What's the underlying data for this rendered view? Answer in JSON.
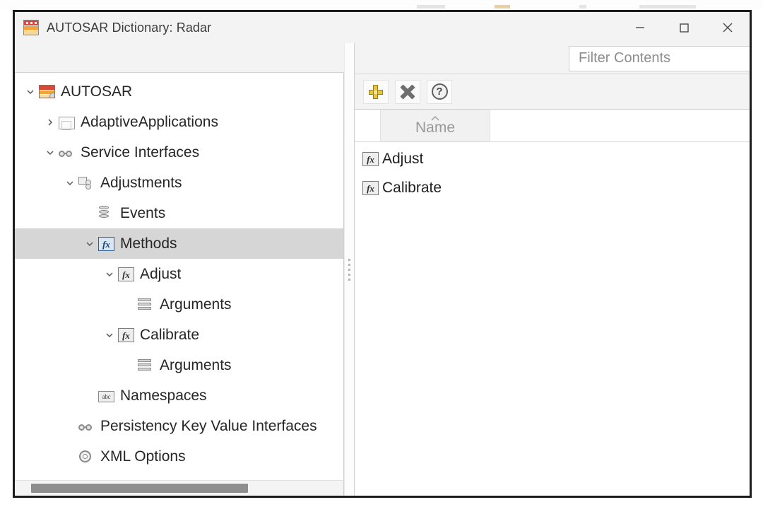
{
  "window": {
    "title": "AUTOSAR Dictionary: Radar",
    "icon": "autosar-app-icon",
    "controls": {
      "minimize": "minimize-icon",
      "maximize": "maximize-icon",
      "close": "close-icon"
    }
  },
  "tree": {
    "nodes": [
      {
        "label": "AUTOSAR",
        "level": 0,
        "icon": "autosar-icon",
        "twisty": "expanded",
        "selected": false
      },
      {
        "label": "AdaptiveApplications",
        "level": 1,
        "icon": "package-square-icon",
        "twisty": "collapsed",
        "selected": false
      },
      {
        "label": "Service Interfaces",
        "level": 1,
        "icon": "service-interface-icon",
        "twisty": "expanded",
        "selected": false
      },
      {
        "label": "Adjustments",
        "level": 2,
        "icon": "adjustments-icon",
        "twisty": "expanded",
        "selected": false
      },
      {
        "label": "Events",
        "level": 3,
        "icon": "events-database-icon",
        "twisty": "none",
        "selected": false
      },
      {
        "label": "Methods",
        "level": 3,
        "icon": "fx-icon-selected",
        "twisty": "expanded",
        "selected": true
      },
      {
        "label": "Adjust",
        "level": 4,
        "icon": "fx-icon",
        "twisty": "expanded",
        "selected": false
      },
      {
        "label": "Arguments",
        "level": 5,
        "icon": "arguments-rows-icon",
        "twisty": "none",
        "selected": false
      },
      {
        "label": "Calibrate",
        "level": 4,
        "icon": "fx-icon",
        "twisty": "expanded",
        "selected": false
      },
      {
        "label": "Arguments",
        "level": 5,
        "icon": "arguments-rows-icon",
        "twisty": "none",
        "selected": false
      },
      {
        "label": "Namespaces",
        "level": 3,
        "icon": "abc-icon",
        "twisty": "none",
        "selected": false
      },
      {
        "label": "Persistency Key Value Interfaces",
        "level": 2,
        "icon": "service-interface-icon",
        "twisty": "none",
        "selected": false
      },
      {
        "label": "XML Options",
        "level": 2,
        "icon": "gear-icon",
        "twisty": "none",
        "selected": false
      }
    ],
    "abc_glyph": "abc"
  },
  "filter": {
    "placeholder": "Filter Contents",
    "value": ""
  },
  "toolbar": {
    "add_label": "add-icon",
    "delete_label": "delete-icon",
    "help_label": "?"
  },
  "list": {
    "column_header": "Name",
    "sort_direction": "ascending",
    "rows": [
      {
        "name": "Adjust",
        "icon": "fx-icon"
      },
      {
        "name": "Calibrate",
        "icon": "fx-icon"
      }
    ]
  },
  "colors": {
    "selection": "#d6d6d6",
    "accent_fx_blue": "#2f5f9e",
    "toolbar_bg": "#f3f3f3",
    "add_icon_gold": "#e8c53e"
  }
}
